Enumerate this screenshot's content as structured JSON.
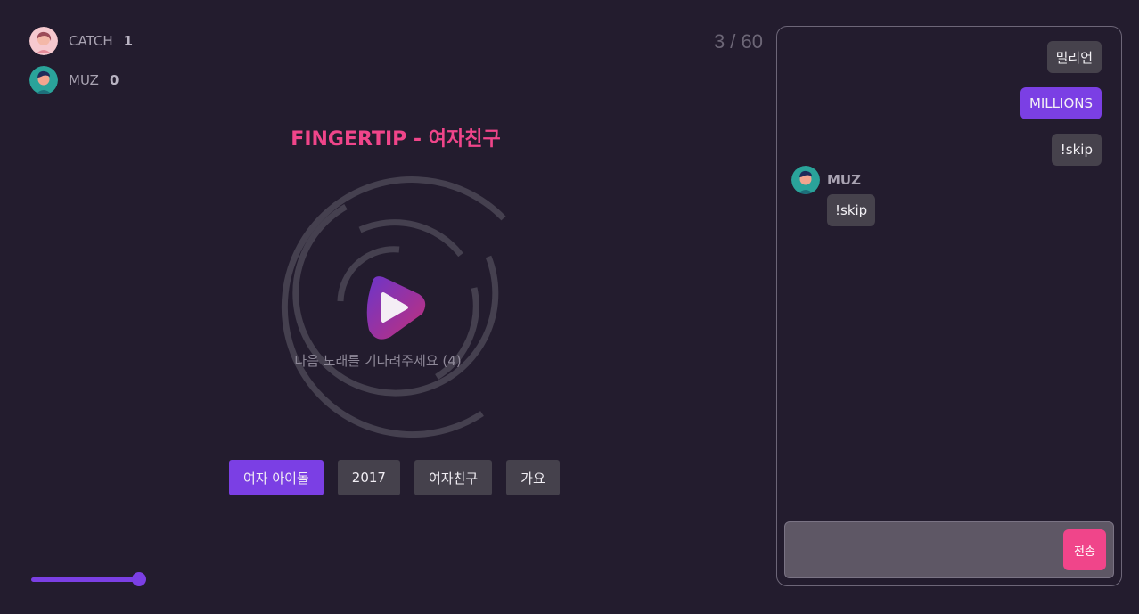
{
  "players": [
    {
      "name": "CATCH",
      "score": "1",
      "avatar": "female-avatar-icon"
    },
    {
      "name": "MUZ",
      "score": "0",
      "avatar": "male-avatar-icon"
    }
  ],
  "progress": {
    "text": "3 / 60",
    "current": 3,
    "total": 60
  },
  "song": {
    "title": "FINGERTIP - 여자친구"
  },
  "status": {
    "wait_text": "다음 노래를 기다려주세요 (4)"
  },
  "tags": [
    "여자 아이돌",
    "2017",
    "여자친구",
    "가요"
  ],
  "volume": {
    "level": 1.0
  },
  "chat": {
    "my_messages": [
      "밀리언",
      "MILLIONS",
      "!skip"
    ],
    "other": {
      "name": "MUZ",
      "message": "!skip"
    },
    "input": {
      "value": "",
      "placeholder": ""
    },
    "send_label": "전송"
  },
  "colors": {
    "accent": "#7b3fe4",
    "pink": "#f0458a",
    "background": "#231c2e"
  }
}
